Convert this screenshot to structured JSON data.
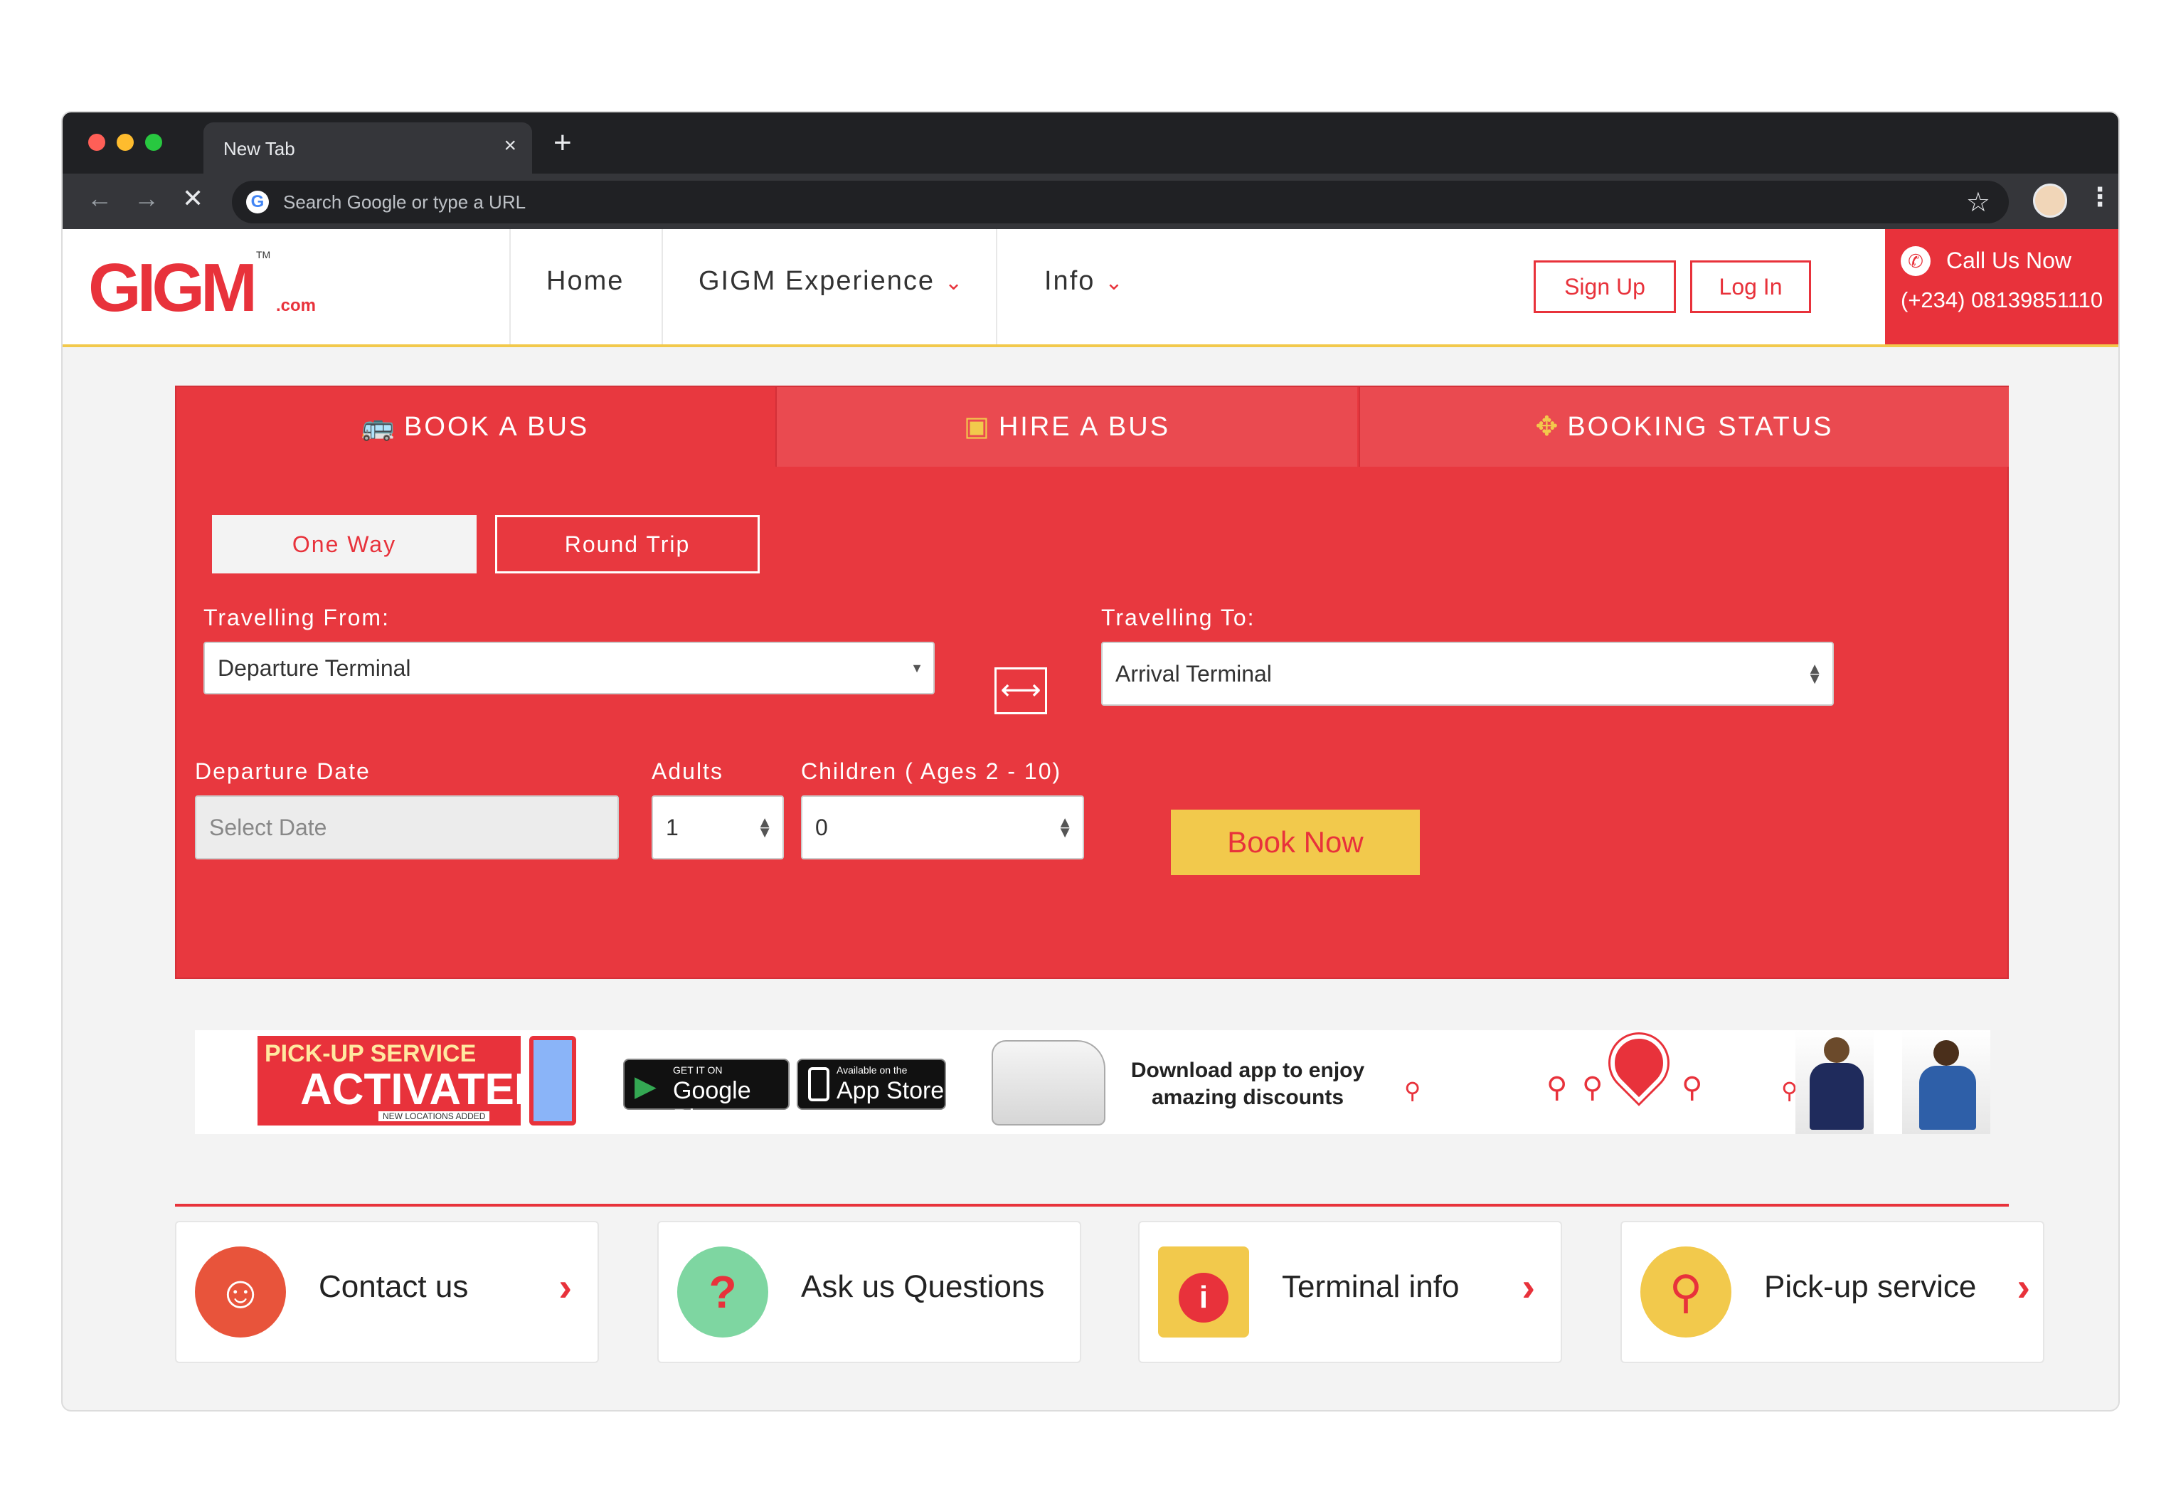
{
  "browser": {
    "tab_title": "New Tab",
    "close_glyph": "×",
    "new_tab_glyph": "+",
    "omnibox_placeholder": "Search Google or type a URL"
  },
  "header": {
    "logo_main": "GIGM",
    "logo_tm": "TM",
    "logo_sub": ".com",
    "nav": {
      "home": "Home",
      "experience": "GIGM Experience",
      "info": "Info"
    },
    "sign_up": "Sign Up",
    "log_in": "Log In",
    "call_title": "Call Us Now",
    "call_phone": "(+234) 08139851110"
  },
  "booking": {
    "tabs": {
      "book": "BOOK A BUS",
      "hire": "HIRE A BUS",
      "status": "BOOKING STATUS"
    },
    "trip_types": {
      "one_way": "One Way",
      "round_trip": "Round Trip",
      "selected": "one_way"
    },
    "from_label": "Travelling From:",
    "from_value": "Departure Terminal",
    "to_label": "Travelling To:",
    "to_value": "Arrival Terminal",
    "date_label": "Departure Date",
    "date_placeholder": "Select Date",
    "adults_label": "Adults",
    "adults_value": "1",
    "children_label": "Children ( Ages 2 - 10)",
    "children_value": "0",
    "book_now": "Book Now"
  },
  "banner": {
    "pickup_line1": "PICK-UP SERVICE",
    "pickup_line2": "ACTIVATED",
    "pickup_line3": "NEW LOCATIONS ADDED",
    "google_small": "GET IT ON",
    "google_big": "Google Play",
    "apple_small": "Available on the",
    "apple_big": "App Store",
    "download_text": "Download app to enjoy amazing discounts"
  },
  "cards": [
    {
      "label": "Contact us",
      "icon": "headset-icon",
      "color": "#e8543b"
    },
    {
      "label": "Ask us Questions",
      "icon": "question-icon",
      "color": "#7ed6a1"
    },
    {
      "label": "Terminal info",
      "icon": "info-pin-icon",
      "color": "#e8323b"
    },
    {
      "label": "Pick-up service",
      "icon": "route-icon",
      "color": "#f2c94c"
    }
  ],
  "colors": {
    "brand_red": "#e8323b",
    "accent_yellow": "#f2c94c"
  }
}
